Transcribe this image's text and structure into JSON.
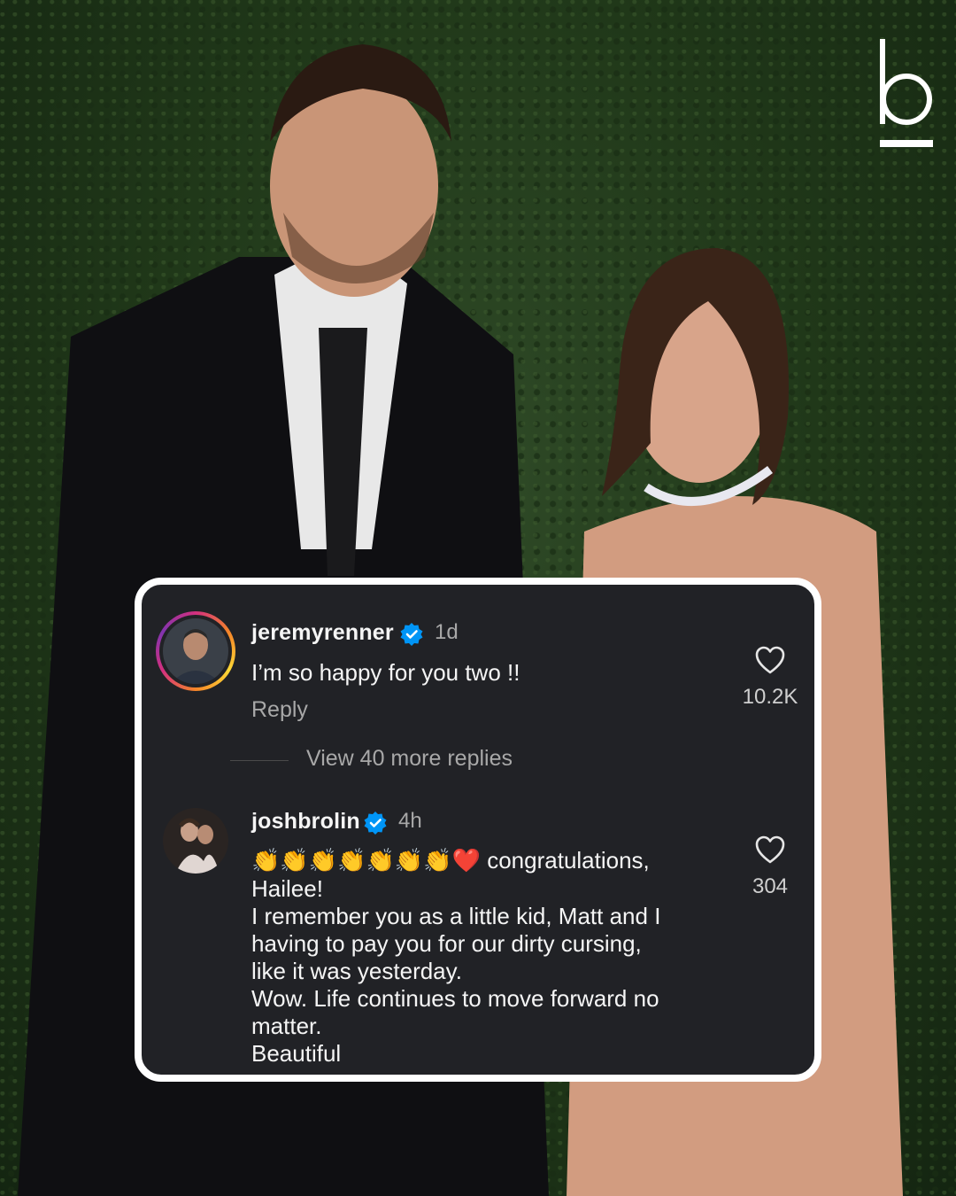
{
  "brand": {
    "logo_letter": "b"
  },
  "comments": [
    {
      "username": "jeremyrenner",
      "time": "1d",
      "text": "I’m so happy for you two !!",
      "reply_label": "Reply",
      "likes": "10.2K",
      "view_more_label": "View 40 more replies"
    },
    {
      "username": "joshbrolin",
      "time": "4h",
      "emoji_prefix": "👏👏👏👏👏👏👏❤️",
      "lines": [
        "congratulations,",
        "Hailee!",
        "I remember you as a little kid, Matt and I",
        "having to pay you for our dirty cursing,",
        "like it was yesterday.",
        "Wow. Life continues to move forward no",
        "matter.",
        "Beautiful"
      ],
      "likes": "304"
    }
  ],
  "colors": {
    "card_bg": "#212226",
    "card_border": "#ffffff",
    "verified_blue": "#0095f6",
    "muted_text": "#a8a8a8"
  }
}
